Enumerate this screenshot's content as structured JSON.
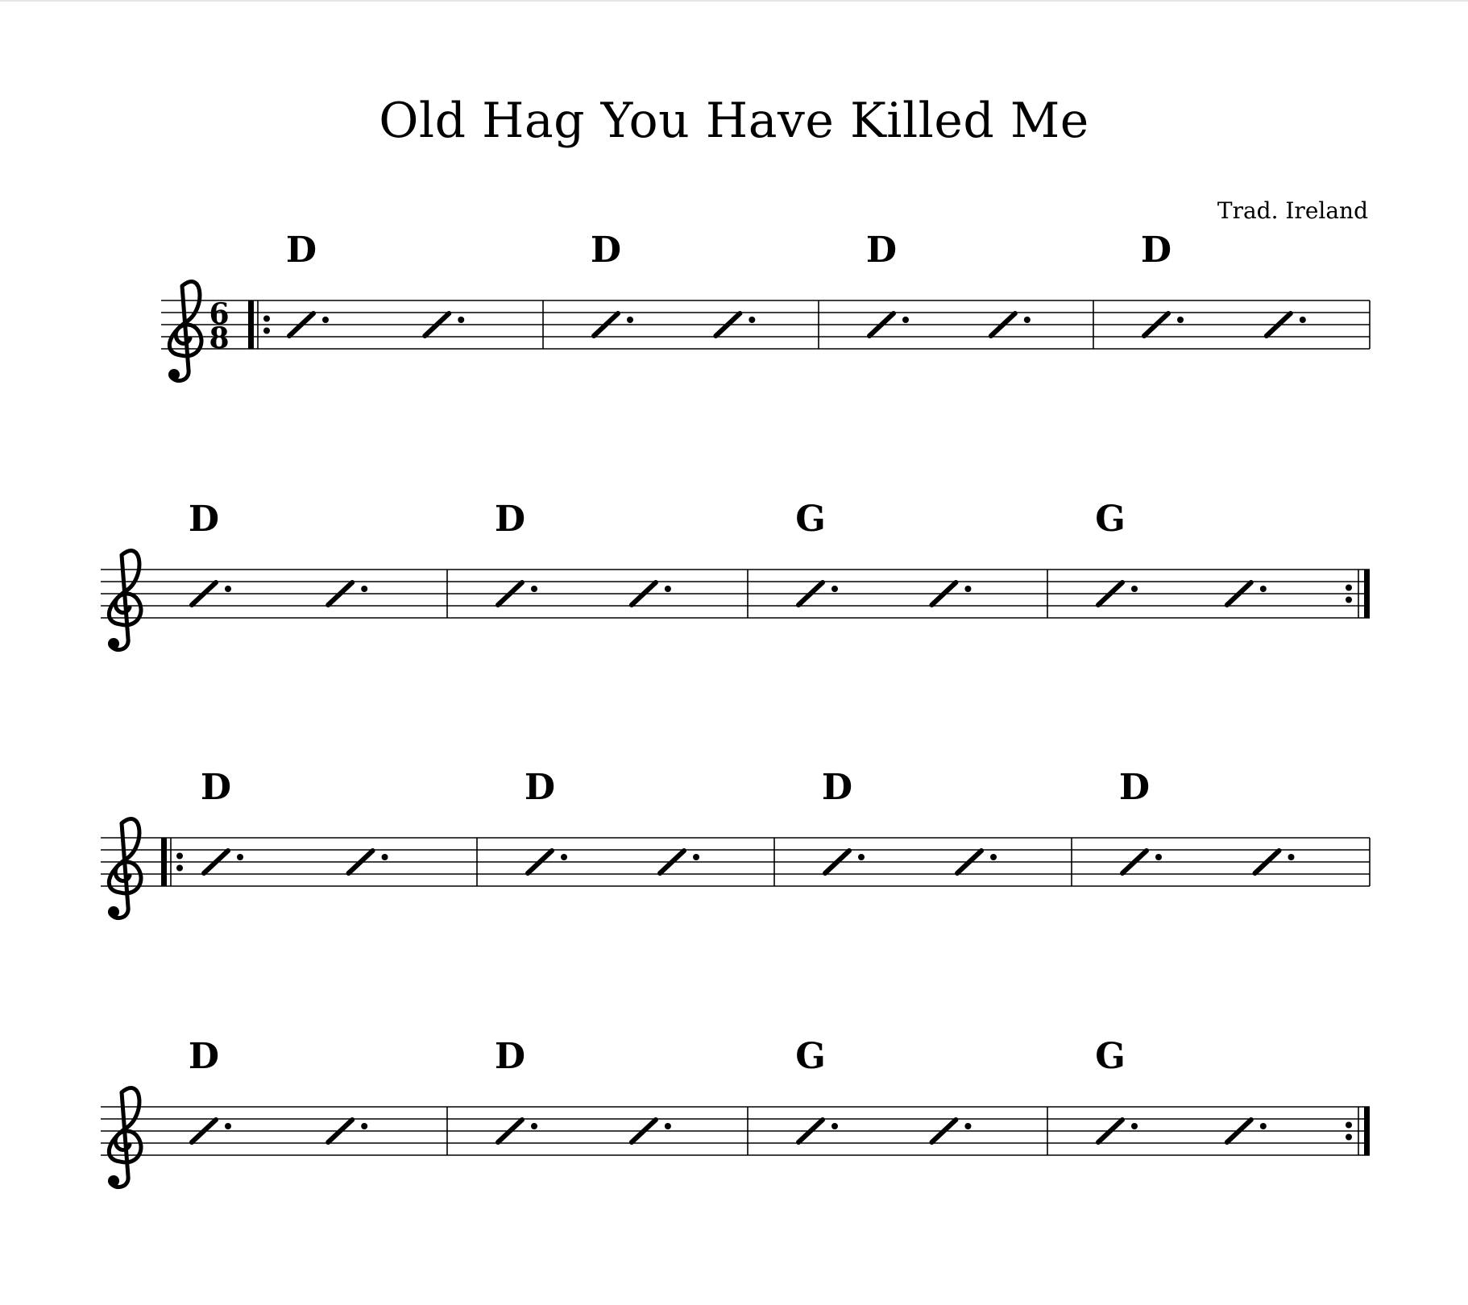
{
  "title": "Old Hag You Have Killed Me",
  "composer": "Trad. Ireland",
  "time_signature": {
    "numerator": "6",
    "denominator": "8"
  },
  "clef": "treble",
  "systems": [
    {
      "start_barline": "repeat-start",
      "end_barline": "single",
      "show_time_signature": true,
      "measures": [
        {
          "chord": "D",
          "beats": 2
        },
        {
          "chord": "D",
          "beats": 2
        },
        {
          "chord": "D",
          "beats": 2
        },
        {
          "chord": "D",
          "beats": 2
        }
      ]
    },
    {
      "start_barline": "none",
      "end_barline": "repeat-end",
      "show_time_signature": false,
      "measures": [
        {
          "chord": "D",
          "beats": 2
        },
        {
          "chord": "D",
          "beats": 2
        },
        {
          "chord": "G",
          "beats": 2
        },
        {
          "chord": "G",
          "beats": 2
        }
      ]
    },
    {
      "start_barline": "repeat-start",
      "end_barline": "single",
      "show_time_signature": false,
      "measures": [
        {
          "chord": "D",
          "beats": 2
        },
        {
          "chord": "D",
          "beats": 2
        },
        {
          "chord": "D",
          "beats": 2
        },
        {
          "chord": "D",
          "beats": 2
        }
      ]
    },
    {
      "start_barline": "none",
      "end_barline": "repeat-end",
      "show_time_signature": false,
      "measures": [
        {
          "chord": "D",
          "beats": 2
        },
        {
          "chord": "D",
          "beats": 2
        },
        {
          "chord": "G",
          "beats": 2
        },
        {
          "chord": "G",
          "beats": 2
        }
      ]
    }
  ]
}
